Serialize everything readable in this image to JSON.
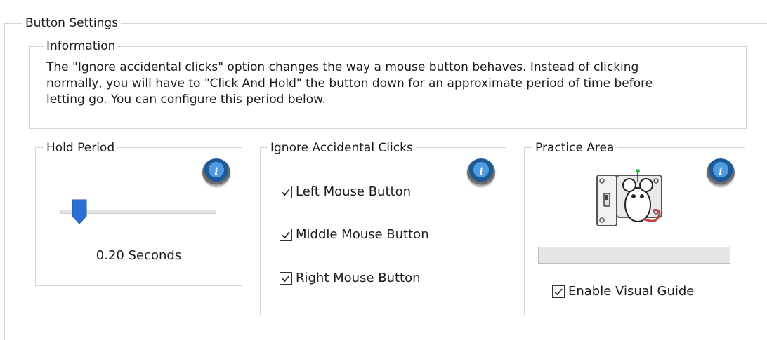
{
  "button_settings": {
    "title": "Button Settings"
  },
  "information": {
    "title": "Information",
    "lines": [
      "The \"Ignore accidental clicks\" option changes the way a mouse button behaves. Instead of clicking",
      "normally, you will have to \"Click And Hold\" the button down for an approximate period of time before",
      "letting go. You can configure this period below."
    ]
  },
  "hold_period": {
    "title": "Hold Period",
    "value_label": "0.20 Seconds",
    "slider_value_fraction": 0.08,
    "info_icon": "info-icon"
  },
  "ignore_clicks": {
    "title": "Ignore Accidental Clicks",
    "info_icon": "info-icon",
    "options": [
      {
        "label": "Left Mouse Button",
        "checked": true
      },
      {
        "label": "Middle Mouse Button",
        "checked": true
      },
      {
        "label": "Right Mouse Button",
        "checked": true
      }
    ]
  },
  "practice_area": {
    "title": "Practice Area",
    "info_icon": "info-icon",
    "image_icon": "mouse-switch-icon",
    "progress_fraction": 0,
    "enable_visual_guide": {
      "label": "Enable Visual Guide",
      "checked": true
    }
  },
  "colors": {
    "group_border": "#d6d6d6",
    "info_blue": "#1e5a95",
    "slider_thumb": "#2a6fd1",
    "progress_bg": "#e6e6e6"
  }
}
